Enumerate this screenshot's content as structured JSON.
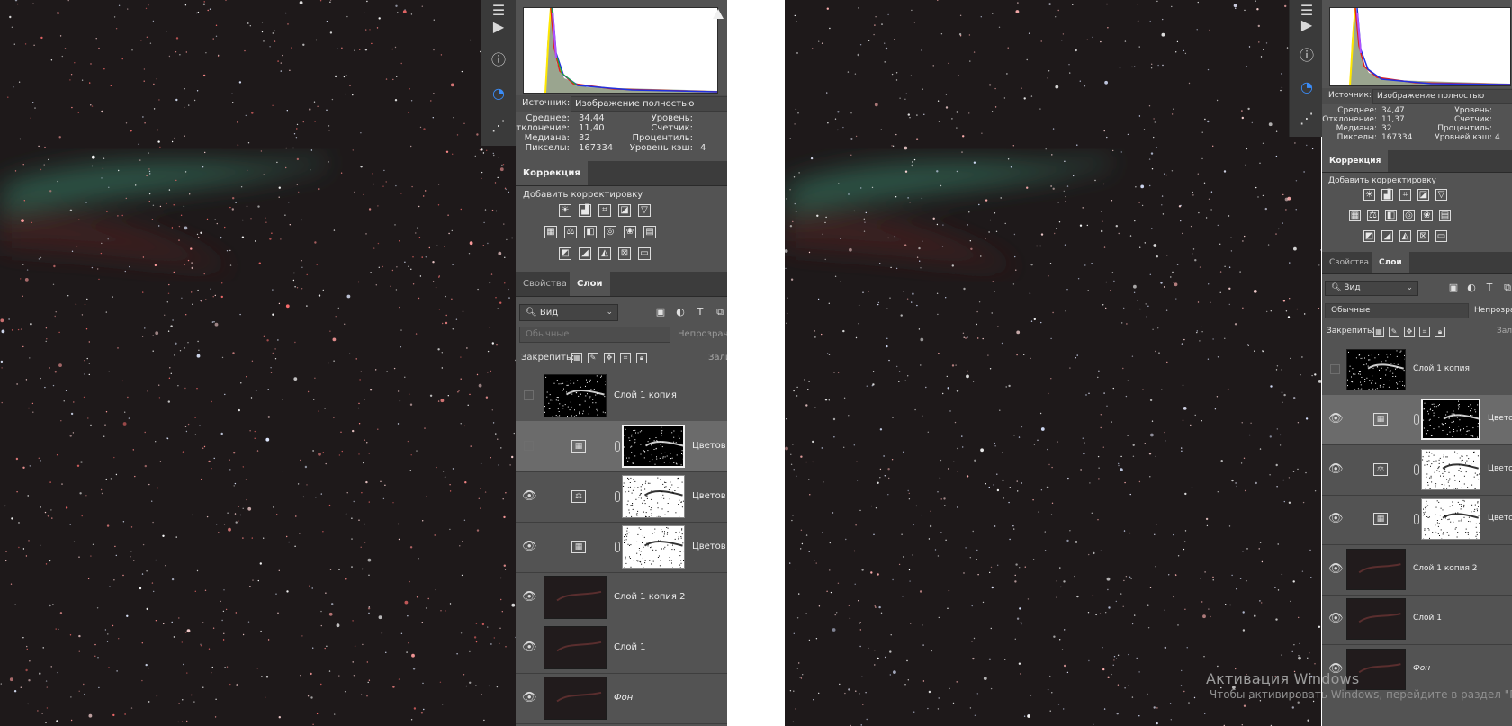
{
  "left": {
    "histogram": {
      "source_label": "Источник:",
      "source_value": "Изображение полностью",
      "stats": {
        "mean_label": "Среднее:",
        "mean": "34,44",
        "dev_label": "Отклонение:",
        "dev": "11,40",
        "median_label": "Медиана:",
        "median": "32",
        "pixels_label": "Пикселы:",
        "pixels": "167334",
        "levels_label": "Уровень:",
        "count_label": "Счетчик:",
        "percentile_label": "Процентиль:",
        "cache_label": "Уровень кэш:",
        "cache": "4"
      }
    },
    "correction": {
      "tab": "Коррекция",
      "add_label": "Добавить корректировку"
    },
    "tabs": {
      "properties": "Свойства",
      "layers": "Слои"
    },
    "filter": {
      "kind": "Вид"
    },
    "blend_mode": "Обычные",
    "opacity_label": "Непрозрачн",
    "lock_label": "Закрепить:",
    "fill_label": "Зали",
    "layers": [
      {
        "name": "Слой 1 копия"
      },
      {
        "name": "Цветов"
      },
      {
        "name": "Цветов"
      },
      {
        "name": "Цветов"
      },
      {
        "name": "Слой 1 копия 2"
      },
      {
        "name": "Слой 1"
      },
      {
        "name": "Фон"
      }
    ]
  },
  "right": {
    "histogram": {
      "source_label": "Источник:",
      "source_value": "Изображение полностью",
      "stats": {
        "mean_label": "Среднее:",
        "mean": "34,47",
        "dev_label": "Отклонение:",
        "dev": "11,37",
        "median_label": "Медиана:",
        "median": "32",
        "pixels_label": "Пикселы:",
        "pixels": "167334",
        "levels_label": "Уровень:",
        "count_label": "Счетчик:",
        "percentile_label": "Процентиль:",
        "cache_label": "Уровней кэш:",
        "cache": "4"
      }
    },
    "correction": {
      "tab": "Коррекция",
      "add_label": "Добавить корректировку"
    },
    "tabs": {
      "properties": "Свойства",
      "layers": "Слои"
    },
    "filter": {
      "kind": "Вид"
    },
    "blend_mode": "Обычные",
    "opacity_label": "Непрозрач",
    "lock_label": "Закрепить:",
    "fill_label": "Зал",
    "layers": [
      {
        "name": "Слой 1 копия"
      },
      {
        "name": "Цвето"
      },
      {
        "name": "Цвето"
      },
      {
        "name": "Цвето"
      },
      {
        "name": "Слой 1 копия 2"
      },
      {
        "name": "Слой 1"
      },
      {
        "name": "Фон"
      }
    ]
  },
  "watermark": {
    "title": "Активация Windows",
    "subtitle": "Чтобы активировать Windows, перейдите в раздел \"Пар"
  },
  "colors": {
    "panel_bg": "#535353",
    "sky_bg": "#1e191a",
    "accent_blue": "#3b8cf7"
  }
}
